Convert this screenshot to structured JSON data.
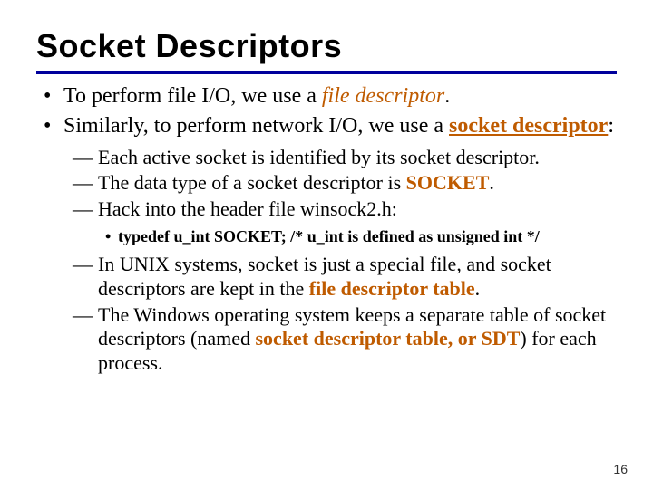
{
  "title": "Socket Descriptors",
  "b1a": "To perform file I/O, we use a ",
  "b1b": "file descriptor",
  "b1c": ".",
  "b2a": "Similarly, to perform network I/O, we use a ",
  "b2b": "socket descriptor",
  "b2c": ":",
  "s1": "Each active socket is identified by its socket descriptor.",
  "s2a": "The data type of a socket descriptor is ",
  "s2b": "SOCKET",
  "s2c": ".",
  "s3": "Hack into the header file winsock2.h:",
  "s3i": "typedef u_int SOCKET;  /* u_int is defined as unsigned int */",
  "s4a": "In UNIX systems, socket is just a special file, and socket descriptors are kept in the ",
  "s4b": "file descriptor table",
  "s4c": ".",
  "s5a": "The Windows operating system keeps a separate table of socket descriptors (named ",
  "s5b": "socket descriptor table, or SDT",
  "s5c": ") for each process.",
  "pagenum": "16"
}
